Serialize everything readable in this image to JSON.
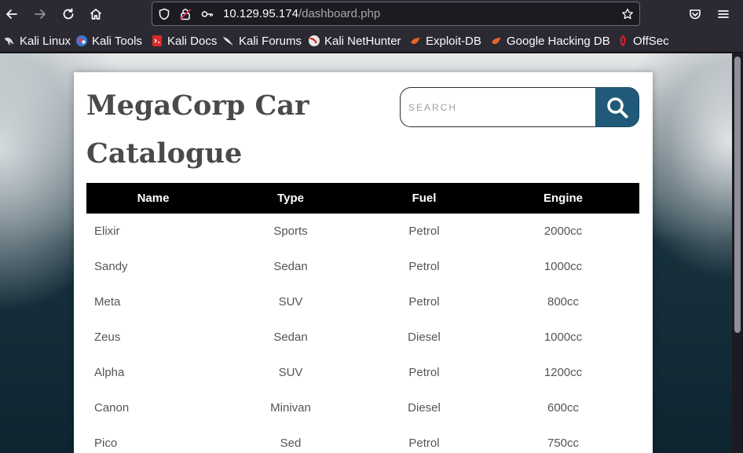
{
  "browser": {
    "url_host": "10.129.95.174",
    "url_path": "/dashboard.php"
  },
  "bookmarks": [
    {
      "label": "Kali Linux",
      "icon": "kali-dragon-icon"
    },
    {
      "label": "Kali Tools",
      "icon": "kali-tools-icon"
    },
    {
      "label": "Kali Docs",
      "icon": "kali-docs-icon"
    },
    {
      "label": "Kali Forums",
      "icon": "kali-forums-icon"
    },
    {
      "label": "Kali NetHunter",
      "icon": "nethunter-icon"
    },
    {
      "label": "Exploit-DB",
      "icon": "exploit-db-icon"
    },
    {
      "label": "Google Hacking DB",
      "icon": "ghdb-icon"
    },
    {
      "label": "OffSec",
      "icon": "offsec-icon"
    }
  ],
  "page": {
    "title": "MegaCorp Car Catalogue",
    "search_placeholder": "SEARCH"
  },
  "table": {
    "headers": [
      "Name",
      "Type",
      "Fuel",
      "Engine"
    ],
    "rows": [
      [
        "Elixir",
        "Sports",
        "Petrol",
        "2000cc"
      ],
      [
        "Sandy",
        "Sedan",
        "Petrol",
        "1000cc"
      ],
      [
        "Meta",
        "SUV",
        "Petrol",
        "800cc"
      ],
      [
        "Zeus",
        "Sedan",
        "Diesel",
        "1000cc"
      ],
      [
        "Alpha",
        "SUV",
        "Petrol",
        "1200cc"
      ],
      [
        "Canon",
        "Minivan",
        "Diesel",
        "600cc"
      ],
      [
        "Pico",
        "Sed",
        "Petrol",
        "750cc"
      ]
    ]
  },
  "colors": {
    "toolbar": "#2b2a33",
    "search_button": "#215a78",
    "table_header": "#000000"
  }
}
